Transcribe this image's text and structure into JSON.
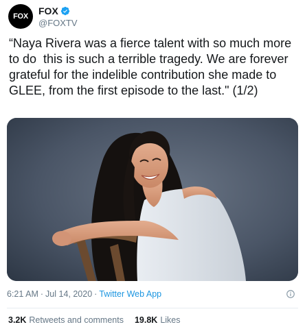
{
  "account": {
    "avatar_text": "FOX",
    "display_name": "FOX",
    "handle": "@FOXTV",
    "verified_icon": "verified-badge-icon"
  },
  "tweet": {
    "text": "“Naya Rivera was a fierce talent with so much more to do  this is such a terrible tragedy. We are forever grateful for the indelible contribution she made to GLEE, from the first episode to the last.\" (1/2)"
  },
  "media": {
    "subject": "photo"
  },
  "meta": {
    "time": "6:21 AM",
    "separator": "·",
    "date": "Jul 14, 2020",
    "source": "Twitter Web App",
    "info_icon": "info-icon"
  },
  "stats": {
    "retweets_count": "3.2K",
    "retweets_label": "Retweets and comments",
    "likes_count": "19.8K",
    "likes_label": "Likes"
  },
  "colors": {
    "link": "#1b95e0",
    "secondary_text": "#657786",
    "verified": "#1da1f2"
  }
}
